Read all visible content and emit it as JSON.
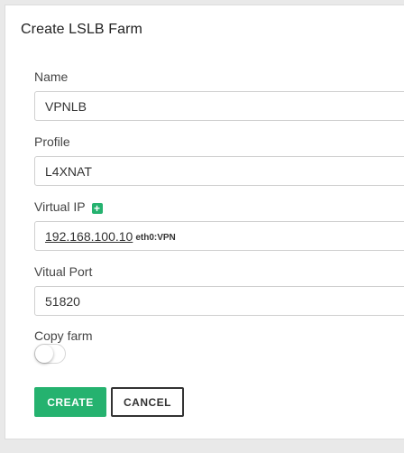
{
  "form": {
    "title": "Create LSLB Farm",
    "name_label": "Name",
    "name_value": "VPNLB",
    "profile_label": "Profile",
    "profile_value": "L4XNAT",
    "vip_label": "Virtual IP",
    "vip_add_icon": "plus-square-icon",
    "vip_address": "192.168.100.10",
    "vip_interface": "eth0:VPN",
    "port_label": "Vitual Port",
    "port_value": "51820",
    "copy_label": "Copy farm",
    "copy_enabled": false,
    "create_label": "CREATE",
    "cancel_label": "CANCEL"
  },
  "colors": {
    "accent": "#25b26f",
    "background": "#e9e9e9",
    "card": "#ffffff"
  }
}
